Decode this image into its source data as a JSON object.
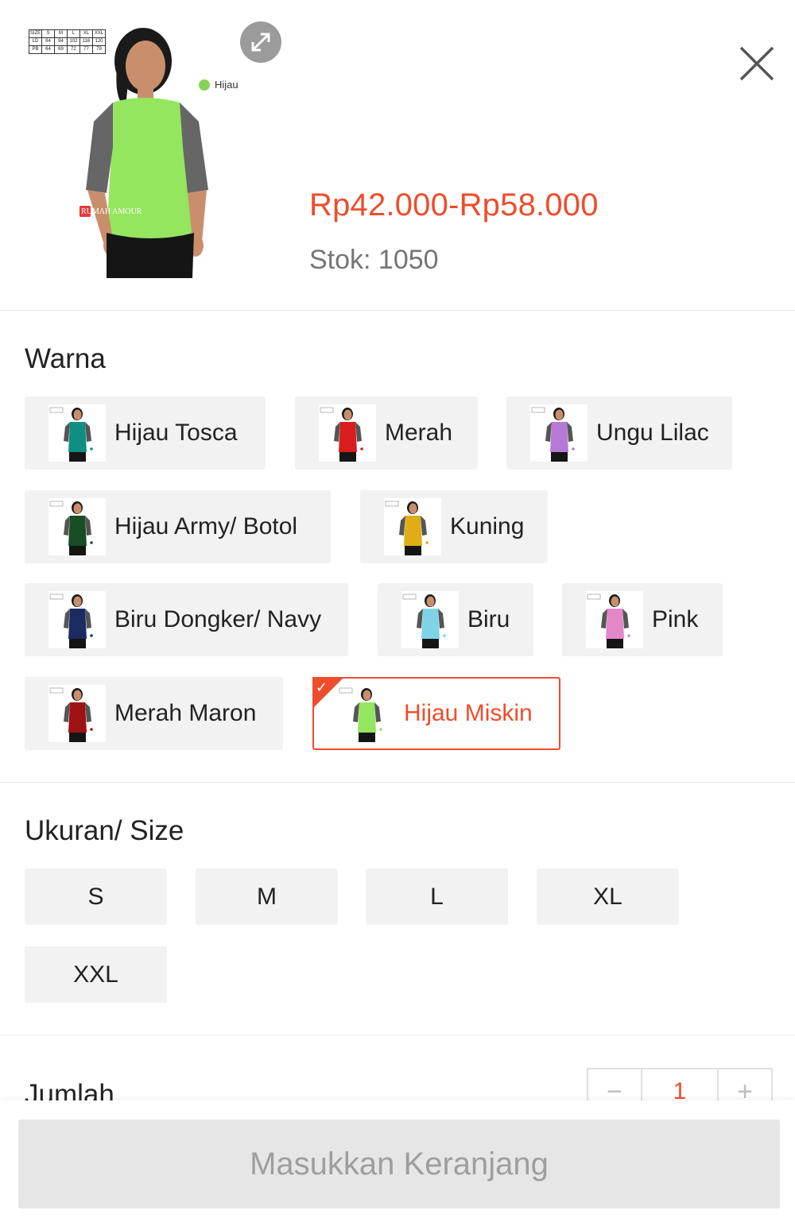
{
  "product": {
    "image_tag": "Hijau",
    "brand_mark": "RUMAH AMOUR",
    "size_chart": [
      [
        "SIZE",
        "S",
        "M",
        "L",
        "XL",
        "XXL"
      ],
      [
        "LD",
        "84",
        "94",
        "102",
        "116",
        "120"
      ],
      [
        "PB",
        "64",
        "69",
        "72",
        "77",
        "79"
      ]
    ],
    "price": "Rp42.000-Rp58.000",
    "stock": "Stok: 1050"
  },
  "colors": {
    "title": "Warna",
    "selected_value": "Hijau Miskin",
    "options": [
      {
        "label": "Hijau Tosca",
        "swatch": "#0f8f83",
        "sleeve": "#555555"
      },
      {
        "label": "Merah",
        "swatch": "#d91c1c",
        "sleeve": "#555555"
      },
      {
        "label": "Ungu Lilac",
        "swatch": "#b67ad6",
        "sleeve": "#555555"
      },
      {
        "label": "Hijau Army/ Botol",
        "swatch": "#184d25",
        "sleeve": "#555555"
      },
      {
        "label": "Kuning",
        "swatch": "#e0ad17",
        "sleeve": "#555555"
      },
      {
        "label": "Biru Dongker/ Navy",
        "swatch": "#1d2b63",
        "sleeve": "#555555"
      },
      {
        "label": "Biru",
        "swatch": "#7fd3e6",
        "sleeve": "#555555"
      },
      {
        "label": "Pink",
        "swatch": "#e387c8",
        "sleeve": "#555555"
      },
      {
        "label": "Merah Maron",
        "swatch": "#9e1212",
        "sleeve": "#555555"
      },
      {
        "label": "Hijau Miskin",
        "swatch": "#93e65e",
        "sleeve": "#555555"
      }
    ]
  },
  "sizes": {
    "title": "Ukuran/ Size",
    "options": [
      "S",
      "M",
      "L",
      "XL",
      "XXL"
    ]
  },
  "quantity": {
    "title": "Jumlah",
    "minus": "−",
    "value": "1",
    "plus": "+"
  },
  "footer": {
    "add_to_cart_label": "Masukkan Keranjang"
  },
  "theme": {
    "accent": "#ee4d2d",
    "chip_bg": "#f2f2f2"
  }
}
